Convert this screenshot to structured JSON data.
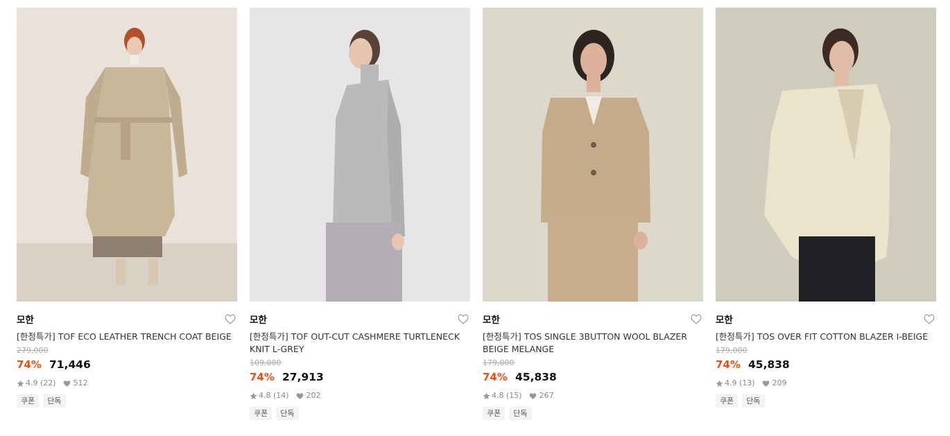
{
  "products": [
    {
      "brand": "모한",
      "title": "[한정특가] TOF ECO LEATHER TRENCH COAT BEIGE",
      "original_price": "279,000",
      "discount": "74%",
      "price": "71,446",
      "rating": "4.9 (22)",
      "likes": "512",
      "tags": [
        "쿠폰",
        "단독"
      ],
      "image_colors": {
        "bg": "#e8e2d8",
        "floor": "#d8d2c6",
        "garment": "#c9b79a",
        "skirt": "#8f7f70",
        "skin": "#e9c9b4",
        "hair": "#b3502c"
      }
    },
    {
      "brand": "모한",
      "title": "[한정특가] TOF OUT-CUT CASHMERE TURTLENECK KNIT L-GREY",
      "original_price": "109,000",
      "discount": "74%",
      "price": "27,913",
      "rating": "4.8 (14)",
      "likes": "202",
      "tags": [
        "쿠폰",
        "단독"
      ],
      "image_colors": {
        "bg": "#e6e6e8",
        "floor": "#e6e6e8",
        "garment": "#b9bbb8",
        "skirt": "#b4aeb4",
        "skin": "#e6c6b2",
        "hair": "#5a4236"
      }
    },
    {
      "brand": "모한",
      "title": "[한정특가] TOS SINGLE 3BUTTON WOOL BLAZER BEIGE MELANGE",
      "original_price": "179,000",
      "discount": "74%",
      "price": "45,838",
      "rating": "4.8 (15)",
      "likes": "267",
      "tags": [
        "쿠폰",
        "단독"
      ],
      "image_colors": {
        "bg": "#dcd8cc",
        "floor": "#dcd8cc",
        "garment": "#c4ab8a",
        "skirt": "#c8ad8c",
        "skin": "#dcb29a",
        "hair": "#2e2420"
      }
    },
    {
      "brand": "모한",
      "title": "[한정특가] TOS OVER FIT COTTON BLAZER I-BEIGE",
      "original_price": "179,000",
      "discount": "74%",
      "price": "45,838",
      "rating": "4.9 (13)",
      "likes": "209",
      "tags": [
        "쿠폰",
        "단독"
      ],
      "image_colors": {
        "bg": "#cfcbbd",
        "floor": "#cfcbbd",
        "garment": "#ebe3cc",
        "skirt": "#1f2126",
        "skin": "#e0bca6",
        "hair": "#3a2c24"
      }
    }
  ],
  "icons": {
    "wishlist": "heart-outline-icon",
    "rating": "star-icon",
    "likes": "heart-filled-icon"
  },
  "colors": {
    "discount": "#e8501a",
    "muted": "#888888",
    "tag_bg": "#f3f3f3"
  }
}
